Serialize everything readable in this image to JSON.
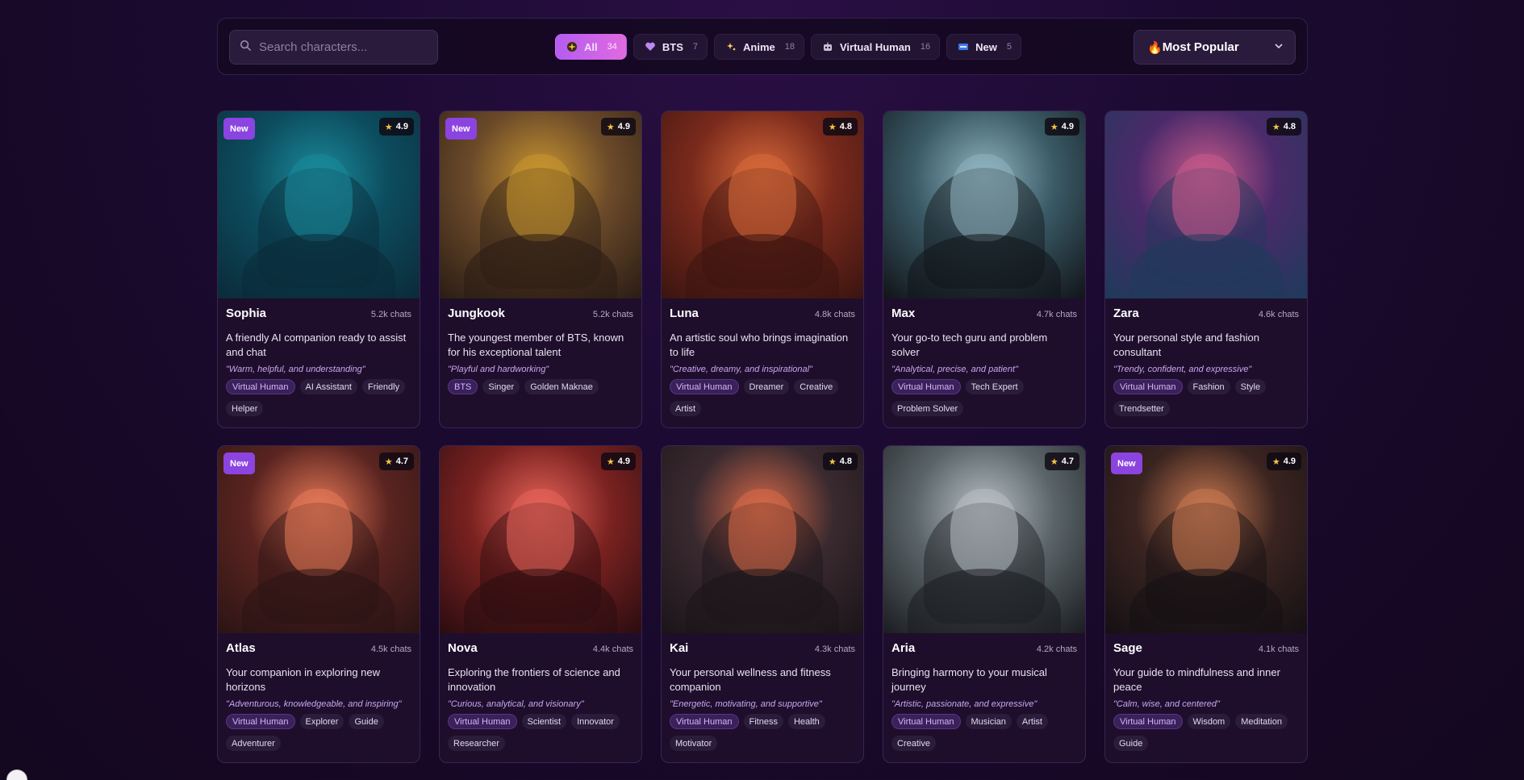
{
  "search": {
    "placeholder": "Search characters..."
  },
  "filters": [
    {
      "label": "All",
      "count": "34",
      "icon": "sparkle-icon",
      "active": true
    },
    {
      "label": "BTS",
      "count": "7",
      "icon": "heart-icon",
      "active": false
    },
    {
      "label": "Anime",
      "count": "18",
      "icon": "star-icon",
      "active": false
    },
    {
      "label": "Virtual Human",
      "count": "16",
      "icon": "robot-icon",
      "active": false
    },
    {
      "label": "New",
      "count": "5",
      "icon": "new-icon",
      "active": false
    }
  ],
  "sort": {
    "icon": "🔥",
    "label": "Most Popular"
  },
  "badge_new_label": "New",
  "characters": [
    {
      "name": "Sophia",
      "chats": "5.2k chats",
      "rating": "4.9",
      "is_new": true,
      "description": "A friendly AI companion ready to assist and chat",
      "traits": "\"Warm, helpful, and understanding\"",
      "tags": [
        "Virtual Human",
        "AI Assistant",
        "Friendly",
        "Helper"
      ],
      "palette": [
        "#0c4c5e",
        "#1a8a9a",
        "#0b2a38"
      ]
    },
    {
      "name": "Jungkook",
      "chats": "5.2k chats",
      "rating": "4.9",
      "is_new": true,
      "description": "The youngest member of BTS, known for his exceptional talent",
      "traits": "\"Playful and hardworking\"",
      "tags": [
        "BTS",
        "Singer",
        "Golden Maknae"
      ],
      "palette": [
        "#6b4a2a",
        "#c9962f",
        "#2a1c14"
      ]
    },
    {
      "name": "Luna",
      "chats": "4.8k chats",
      "rating": "4.8",
      "is_new": false,
      "description": "An artistic soul who brings imagination to life",
      "traits": "\"Creative, dreamy, and inspirational\"",
      "tags": [
        "Virtual Human",
        "Dreamer",
        "Creative",
        "Artist"
      ],
      "palette": [
        "#7a2a1c",
        "#d86a3a",
        "#3a1410"
      ]
    },
    {
      "name": "Max",
      "chats": "4.7k chats",
      "rating": "4.9",
      "is_new": false,
      "description": "Your go-to tech guru and problem solver",
      "traits": "\"Analytical, precise, and patient\"",
      "tags": [
        "Virtual Human",
        "Tech Expert",
        "Problem Solver"
      ],
      "palette": [
        "#3a5a66",
        "#8fb4bf",
        "#111418"
      ]
    },
    {
      "name": "Zara",
      "chats": "4.6k chats",
      "rating": "4.8",
      "is_new": false,
      "description": "Your personal style and fashion consultant",
      "traits": "\"Trendy, confident, and expressive\"",
      "tags": [
        "Virtual Human",
        "Fashion",
        "Style",
        "Trendsetter"
      ],
      "palette": [
        "#4a2a6a",
        "#c85a8a",
        "#1e3a5a"
      ]
    },
    {
      "name": "Atlas",
      "chats": "4.5k chats",
      "rating": "4.7",
      "is_new": true,
      "description": "Your companion in exploring new horizons",
      "traits": "\"Adventurous, knowledgeable, and inspiring\"",
      "tags": [
        "Virtual Human",
        "Explorer",
        "Guide",
        "Adventurer"
      ],
      "palette": [
        "#5a2420",
        "#e87a58",
        "#2a1414"
      ]
    },
    {
      "name": "Nova",
      "chats": "4.4k chats",
      "rating": "4.9",
      "is_new": false,
      "description": "Exploring the frontiers of science and innovation",
      "traits": "\"Curious, analytical, and visionary\"",
      "tags": [
        "Virtual Human",
        "Scientist",
        "Innovator",
        "Researcher"
      ],
      "palette": [
        "#7a2220",
        "#e8645a",
        "#2a0c10"
      ]
    },
    {
      "name": "Kai",
      "chats": "4.3k chats",
      "rating": "4.8",
      "is_new": false,
      "description": "Your personal wellness and fitness companion",
      "traits": "\"Energetic, motivating, and supportive\"",
      "tags": [
        "Virtual Human",
        "Fitness",
        "Health",
        "Motivator"
      ],
      "palette": [
        "#3a2a30",
        "#d86a48",
        "#1a1418"
      ]
    },
    {
      "name": "Aria",
      "chats": "4.2k chats",
      "rating": "4.7",
      "is_new": false,
      "description": "Bringing harmony to your musical journey",
      "traits": "\"Artistic, passionate, and expressive\"",
      "tags": [
        "Virtual Human",
        "Musician",
        "Artist",
        "Creative"
      ],
      "palette": [
        "#5a6468",
        "#b8c0c4",
        "#1a1c20"
      ]
    },
    {
      "name": "Sage",
      "chats": "4.1k chats",
      "rating": "4.9",
      "is_new": true,
      "description": "Your guide to mindfulness and inner peace",
      "traits": "\"Calm, wise, and centered\"",
      "tags": [
        "Virtual Human",
        "Wisdom",
        "Meditation",
        "Guide"
      ],
      "palette": [
        "#3a2420",
        "#c87850",
        "#141014"
      ]
    }
  ]
}
